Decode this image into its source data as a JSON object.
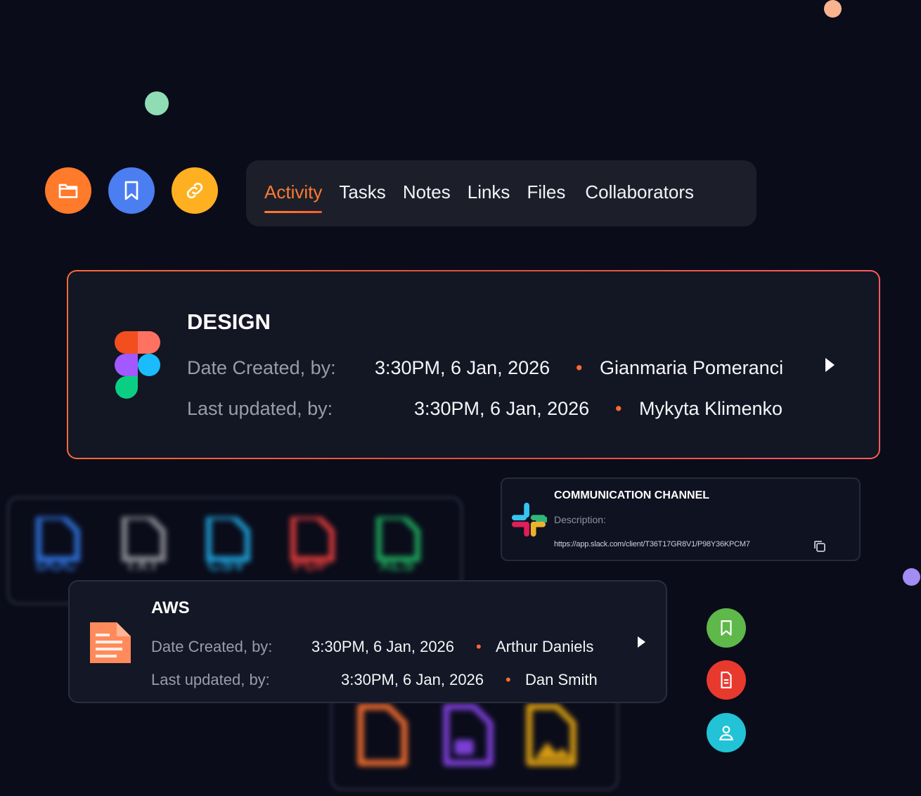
{
  "tabs": [
    "Activity",
    "Tasks",
    "Notes",
    "Links",
    "Files",
    "Collaborators"
  ],
  "active_tab": "Activity",
  "quick_actions": [
    {
      "icon": "folder-icon",
      "color": "#ff7a2a"
    },
    {
      "icon": "bookmark-icon",
      "color": "#4b7ef0"
    },
    {
      "icon": "link-icon",
      "color": "#ffb020"
    }
  ],
  "design_card": {
    "title": "DESIGN",
    "created_label": "Date Created, by:",
    "created_time": "3:30PM, 6 Jan, 2026",
    "created_by": "Gianmaria Pomeranci",
    "updated_label": "Last updated, by:",
    "updated_time": "3:30PM, 6 Jan, 2026",
    "updated_by": "Mykyta Klimenko",
    "icon": "figma-icon"
  },
  "file_types": [
    "DOC",
    "TXT",
    "CSV",
    "PDF",
    "XLS"
  ],
  "file_type_colors": [
    "#2d6fd6",
    "#8a8a90",
    "#1f9bd1",
    "#d63a3a",
    "#1ea35a"
  ],
  "comm_card": {
    "title": "COMMUNICATION CHANNEL",
    "description_label": "Description:",
    "url": "https://app.slack.com/client/T36T17GR8V1/P98Y36KPCM7",
    "icon": "slack-icon"
  },
  "aws_card": {
    "title": "AWS",
    "created_label": "Date Created, by:",
    "created_time": "3:30PM, 6 Jan, 2026",
    "created_by": "Arthur Daniels",
    "updated_label": "Last updated, by:",
    "updated_time": "3:30PM, 6 Jan, 2026",
    "updated_by": "Dan Smith",
    "icon": "document-icon"
  },
  "side_actions": [
    {
      "icon": "bookmark-icon",
      "color": "#5fb84a"
    },
    {
      "icon": "document-icon",
      "color": "#e8392e"
    },
    {
      "icon": "user-icon",
      "color": "#22c3d6"
    }
  ],
  "bullet": "•"
}
